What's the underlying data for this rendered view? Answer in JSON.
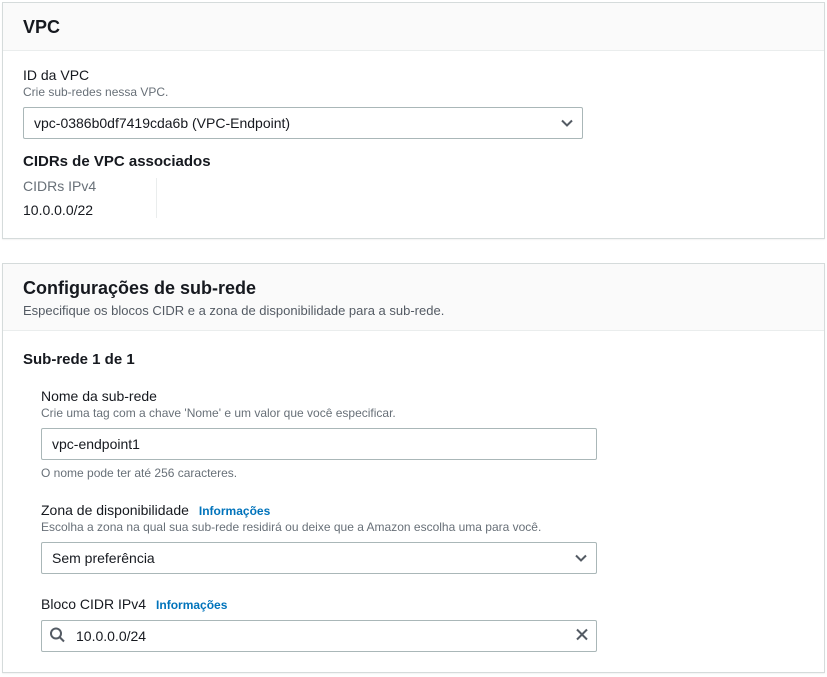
{
  "vpc_panel": {
    "title": "VPC",
    "id_label": "ID da VPC",
    "id_help": "Crie sub-redes nessa VPC.",
    "selected_vpc": "vpc-0386b0df7419cda6b (VPC-Endpoint)",
    "assoc_cidrs_title": "CIDRs de VPC associados",
    "ipv4_label": "CIDRs IPv4",
    "ipv4_value": "10.0.0.0/22"
  },
  "subnet_panel": {
    "title": "Configurações de sub-rede",
    "subtitle": "Especifique os blocos CIDR e a zona de disponibilidade para a sub-rede.",
    "count_heading": "Sub-rede 1 de 1",
    "name": {
      "label": "Nome da sub-rede",
      "help": "Crie uma tag com a chave 'Nome' e um valor que você especificar.",
      "value": "vpc-endpoint1",
      "note": "O nome pode ter até 256 caracteres."
    },
    "az": {
      "label": "Zona de disponibilidade",
      "info": "Informações",
      "help": "Escolha a zona na qual sua sub-rede residirá ou deixe que a Amazon escolha uma para você.",
      "value": "Sem preferência"
    },
    "cidr": {
      "label": "Bloco CIDR IPv4",
      "info": "Informações",
      "value": "10.0.0.0/24"
    }
  }
}
